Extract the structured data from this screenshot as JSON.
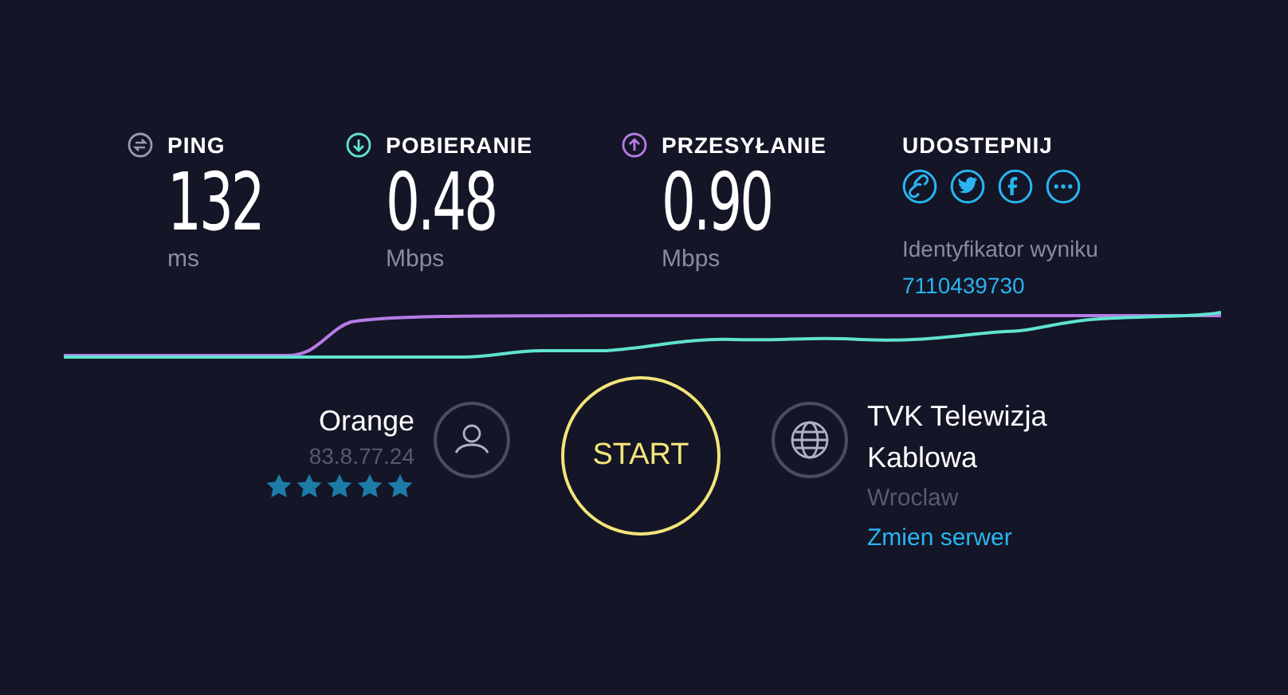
{
  "metrics": [
    {
      "kind": "ping",
      "label": "PING",
      "value": "132",
      "unit": "ms"
    },
    {
      "kind": "download",
      "label": "POBIERANIE",
      "value": "0.48",
      "unit": "Mbps"
    },
    {
      "kind": "upload",
      "label": "PRZESYŁANIE",
      "value": "0.90",
      "unit": "Mbps"
    }
  ],
  "share": {
    "title": "UDOSTEPNIJ",
    "buttons": [
      {
        "kind": "link"
      },
      {
        "kind": "twitter"
      },
      {
        "kind": "facebook"
      },
      {
        "kind": "more"
      }
    ],
    "result_label": "Identyfikator wyniku",
    "result_id": "7110439730"
  },
  "isp": {
    "name": "Orange",
    "ip": "83.8.77.24",
    "stars": 5
  },
  "start_button": {
    "label": "START"
  },
  "server": {
    "name": "TVK Telewizja Kablowa",
    "city": "Wroclaw",
    "change_link": "Zmien serwer"
  }
}
